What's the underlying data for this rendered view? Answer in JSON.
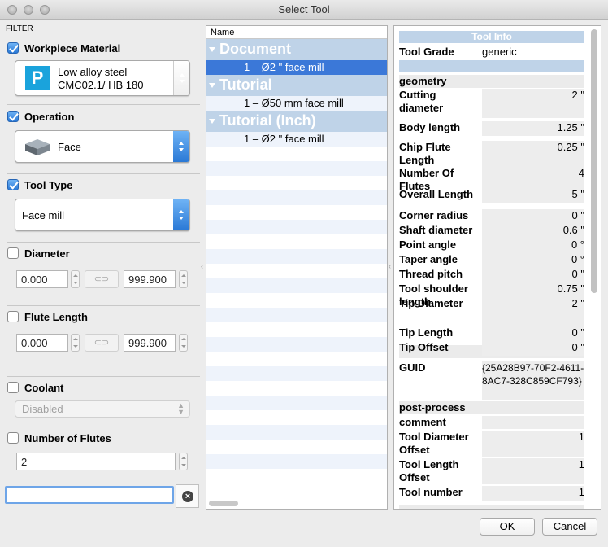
{
  "window": {
    "title": "Select Tool"
  },
  "filter": {
    "label": "FILTER",
    "workpiece_material": {
      "label": "Workpiece Material",
      "checked": true,
      "badge": "P",
      "line1": "Low alloy steel",
      "line2": "CMC02.1/ HB 180"
    },
    "operation": {
      "label": "Operation",
      "checked": true,
      "value": "Face"
    },
    "tool_type": {
      "label": "Tool Type",
      "checked": true,
      "value": "Face mill"
    },
    "diameter": {
      "label": "Diameter",
      "checked": false,
      "min": "0.000",
      "max": "999.900"
    },
    "flute_length": {
      "label": "Flute Length",
      "checked": false,
      "min": "0.000",
      "max": "999.900"
    },
    "coolant": {
      "label": "Coolant",
      "checked": false,
      "value": "Disabled"
    },
    "number_of_flutes": {
      "label": "Number of Flutes",
      "checked": false,
      "value": "2"
    },
    "search": {
      "value": ""
    }
  },
  "tool_list": {
    "column_header": "Name",
    "groups": [
      {
        "name": "Document",
        "items": [
          "1 – Ø2 \" face mill"
        ]
      },
      {
        "name": "Tutorial",
        "items": [
          "1 – Ø50 mm face mill"
        ]
      },
      {
        "name": "Tutorial (Inch)",
        "items": [
          "1 – Ø2 \" face mill"
        ]
      }
    ]
  },
  "tool_info": {
    "title": "Tool Info",
    "tool_grade_key": "Tool Grade",
    "tool_grade_value": "generic",
    "geometry_header": "geometry",
    "geometry": [
      {
        "k": "Cutting diameter",
        "v": "2 \""
      },
      {
        "k": "Body length",
        "v": "1.25 \""
      },
      {
        "k": "Chip Flute Length",
        "v": "0.25 \""
      },
      {
        "k": "Number Of Flutes",
        "v": "4"
      },
      {
        "k": "Overall Length",
        "v": "5 \""
      },
      {
        "k": "Corner radius",
        "v": "0 \""
      },
      {
        "k": "Shaft diameter",
        "v": "0.6 \""
      },
      {
        "k": "Point angle",
        "v": "0 °"
      },
      {
        "k": "Taper angle",
        "v": "0 °"
      },
      {
        "k": "Thread pitch",
        "v": "0 \""
      },
      {
        "k": "Tool shoulder length",
        "v": "0.75 \""
      },
      {
        "k": "Tip Diameter",
        "v": "2 \""
      },
      {
        "k": "Tip Length",
        "v": "0 \""
      },
      {
        "k": "Tip Offset",
        "v": "0 \""
      }
    ],
    "guid_key": "GUID",
    "guid_value": "{25A28B97-70F2-4611-8AC7-328C859CF793}",
    "post_header": "post-process",
    "post": [
      {
        "k": "comment",
        "v": ""
      },
      {
        "k": "Tool Diameter Offset",
        "v": "1"
      },
      {
        "k": "Tool Length Offset",
        "v": "1"
      },
      {
        "k": "Tool number",
        "v": "1"
      }
    ]
  },
  "buttons": {
    "ok": "OK",
    "cancel": "Cancel"
  }
}
